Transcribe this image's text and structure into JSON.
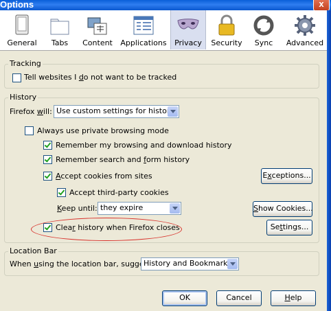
{
  "window": {
    "title": "Options",
    "close_symbol": "x"
  },
  "toolbar": {
    "items": [
      {
        "label": "General",
        "icon": "general-icon"
      },
      {
        "label": "Tabs",
        "icon": "tabs-icon"
      },
      {
        "label": "Content",
        "icon": "content-icon"
      },
      {
        "label": "Applications",
        "icon": "applications-icon"
      },
      {
        "label": "Privacy",
        "icon": "privacy-mask-icon",
        "selected": true
      },
      {
        "label": "Security",
        "icon": "padlock-icon"
      },
      {
        "label": "Sync",
        "icon": "sync-icon"
      },
      {
        "label": "Advanced",
        "icon": "gear-icon"
      }
    ]
  },
  "tracking": {
    "legend": "Tracking",
    "dnt": {
      "label_a": "Tell websites I ",
      "label_u": "d",
      "label_b": "o not want to be tracked",
      "checked": false
    }
  },
  "history": {
    "legend": "History",
    "will_label_a": "Firefox ",
    "will_label_u": "w",
    "will_label_b": "ill:",
    "mode_value": "Use custom settings for history",
    "private_mode": {
      "label": "Always use private browsing mode",
      "checked": false
    },
    "remember_browsing": {
      "label": "Remember my browsing and download history",
      "checked": true
    },
    "remember_search": {
      "label_a": "Remember search and ",
      "label_u": "f",
      "label_b": "orm history",
      "checked": true
    },
    "accept_cookies": {
      "label_a": "",
      "label_u": "A",
      "label_b": "ccept cookies from sites",
      "checked": true
    },
    "exceptions_button": {
      "label_a": "E",
      "label_u": "x",
      "label_b": "ceptions..."
    },
    "third_party": {
      "label": "Accept third-party cookies",
      "checked": true
    },
    "keep_until_label_a": "",
    "keep_until_label_u": "K",
    "keep_until_label_b": "eep until:",
    "keep_until_value": "they expire",
    "show_cookies_button": {
      "label_a": "",
      "label_u": "S",
      "label_b": "how Cookies..."
    },
    "clear_on_close": {
      "label_a": "Clea",
      "label_u": "r",
      "label_b": " history when Firefox closes",
      "checked": true
    },
    "settings_button": {
      "label_a": "Se",
      "label_u": "t",
      "label_b": "tings..."
    }
  },
  "location_bar": {
    "legend": "Location Bar",
    "suggest_label_a": "When ",
    "suggest_label_u": "u",
    "suggest_label_b": "sing the location bar, suggest:",
    "suggest_value": "History and Bookmarks"
  },
  "footer": {
    "ok_label": "OK",
    "cancel_label": "Cancel",
    "help_label_u": "H",
    "help_label_b": "elp"
  },
  "colors": {
    "annotation_ellipse": "#d8322c",
    "selected_tab_bg": "#d9dff0",
    "checkmark": "#21a121"
  }
}
